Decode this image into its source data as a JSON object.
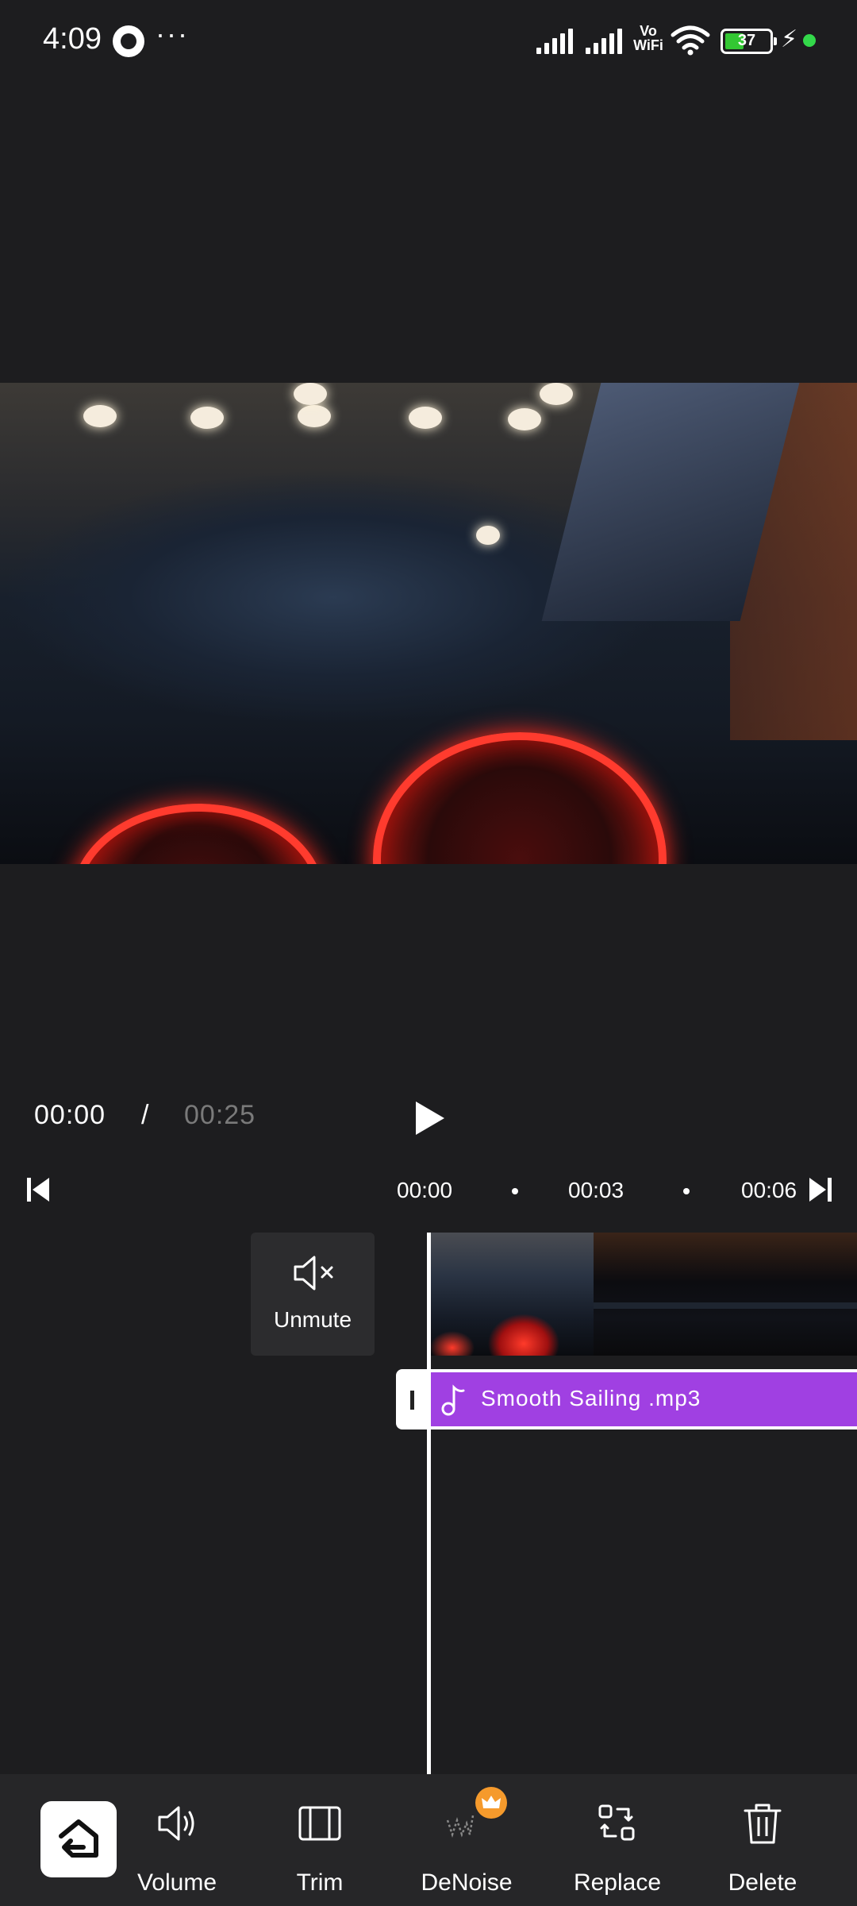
{
  "status_bar": {
    "time": "4:09",
    "battery_level": "37",
    "network_label": "Vo WiFi",
    "icons": [
      "app-icon",
      "more-icon",
      "signal-icon",
      "signal-icon",
      "volte-icon",
      "wifi-icon",
      "battery-icon",
      "charging-bolt-icon",
      "green-dot-icon"
    ]
  },
  "player": {
    "current_time": "00:00",
    "separator": "/",
    "total_time": "00:25"
  },
  "timeline": {
    "ticks": [
      "00:00",
      "00:03",
      "00:06"
    ],
    "unmute_label": "Unmute",
    "audio_clip_name": "Smooth Sailing .mp3",
    "audio_color": "#a040e2"
  },
  "toolbar": {
    "items": [
      {
        "label": "Volume",
        "icon": "volume-icon"
      },
      {
        "label": "Trim",
        "icon": "trim-icon"
      },
      {
        "label": "DeNoise",
        "icon": "denoise-icon",
        "premium": true
      },
      {
        "label": "Replace",
        "icon": "replace-icon"
      },
      {
        "label": "Delete",
        "icon": "trash-icon"
      }
    ]
  }
}
